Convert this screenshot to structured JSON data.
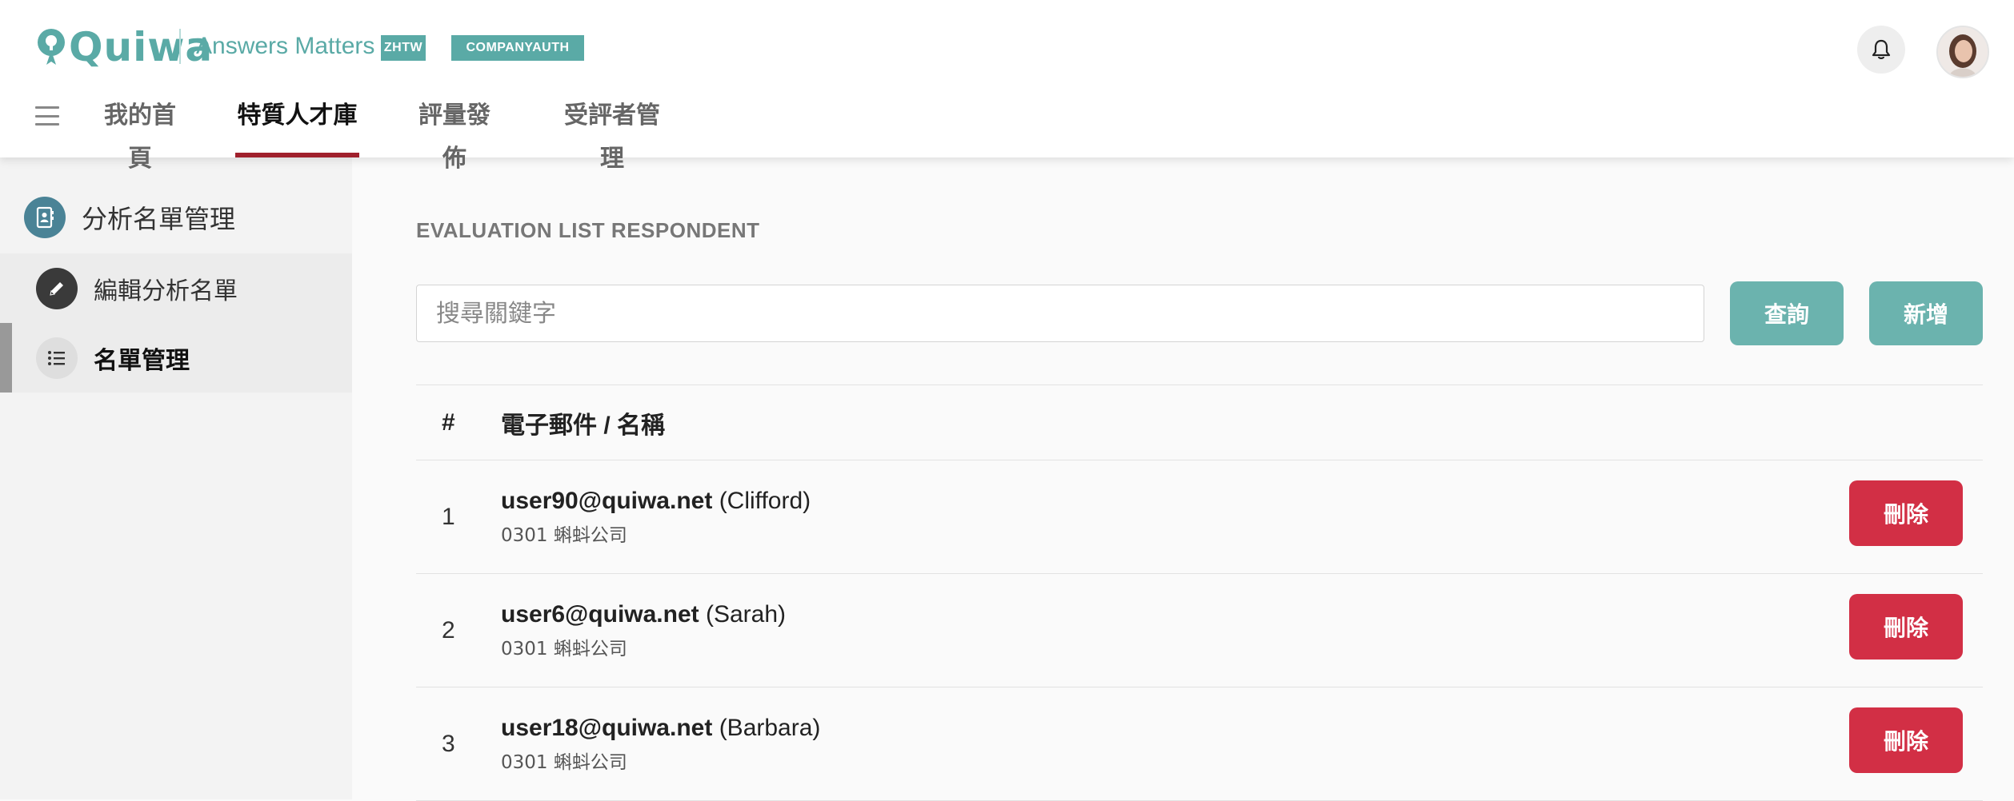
{
  "header": {
    "logo": "Quiwa",
    "tagline": "Answers Matters",
    "lang_badge": "ZHTW",
    "company_badge": "COMPANYAUTH",
    "nav": [
      {
        "label": "我的首頁",
        "active": false
      },
      {
        "label": "特質人才庫",
        "active": true
      },
      {
        "label": "評量發佈",
        "active": false
      },
      {
        "label": "受評者管理",
        "active": false
      }
    ]
  },
  "sidebar": {
    "title": "分析名單管理",
    "items": [
      {
        "label": "編輯分析名單",
        "icon": "pencil-icon",
        "active": false
      },
      {
        "label": "名單管理",
        "icon": "list-icon",
        "active": true
      }
    ]
  },
  "main": {
    "title": "EVALUATION LIST RESPONDENT",
    "search_placeholder": "搜尋關鍵字",
    "query_label": "查詢",
    "add_label": "新增",
    "table": {
      "columns": [
        "#",
        "電子郵件 / 名稱"
      ],
      "delete_label": "刪除",
      "rows": [
        {
          "num": "1",
          "email": "user90@quiwa.net",
          "name": "(Clifford)",
          "company": "0301 蝌蚪公司"
        },
        {
          "num": "2",
          "email": "user6@quiwa.net",
          "name": "(Sarah)",
          "company": "0301 蝌蚪公司"
        },
        {
          "num": "3",
          "email": "user18@quiwa.net",
          "name": "(Barbara)",
          "company": "0301 蝌蚪公司"
        }
      ]
    }
  },
  "colors": {
    "brand_teal": "#5aaaa6",
    "button_teal": "#6bb3ae",
    "delete_red": "#d22f45",
    "active_underline": "#a0202c"
  }
}
